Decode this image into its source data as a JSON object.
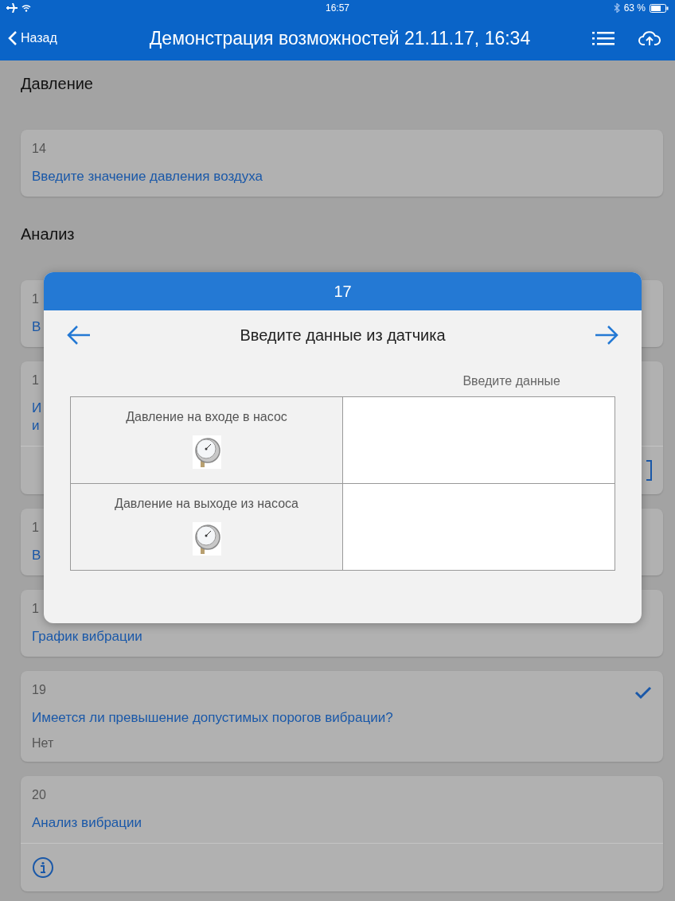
{
  "status_bar": {
    "time": "16:57",
    "battery": "63 %"
  },
  "nav": {
    "back": "Назад",
    "title": "Демонстрация возможностей 21.11.17, 16:34"
  },
  "sections": [
    {
      "heading": "Давление",
      "cards": [
        {
          "number": "14",
          "title_lines": [
            "Введите значение давления воздуха"
          ],
          "checked": false
        }
      ]
    },
    {
      "heading": "Анализ",
      "cards": [
        {
          "number": "1",
          "title_lines": [
            "В"
          ],
          "checked": false
        },
        {
          "number": "1",
          "title_lines": [
            "И",
            "и"
          ],
          "checked": false,
          "footer": {
            "kind": "bracket"
          }
        },
        {
          "number": "1",
          "title_lines": [
            "В"
          ],
          "checked": false
        },
        {
          "number": "1",
          "title_lines": [
            "График вибрации"
          ],
          "checked": false
        },
        {
          "number": "19",
          "title_lines": [
            "Имеется ли превышение допустимых порогов вибрации?"
          ],
          "answer": "Нет",
          "checked": true
        },
        {
          "number": "20",
          "title_lines": [
            "Анализ вибрации"
          ],
          "checked": false,
          "footer": {
            "kind": "info"
          }
        }
      ]
    }
  ],
  "modal": {
    "number": "17",
    "title": "Введите данные из датчика",
    "column_header": "Введите данные",
    "rows": [
      {
        "label": "Давление на входе в насос"
      },
      {
        "label": "Давление на выходе из насоса"
      }
    ]
  }
}
